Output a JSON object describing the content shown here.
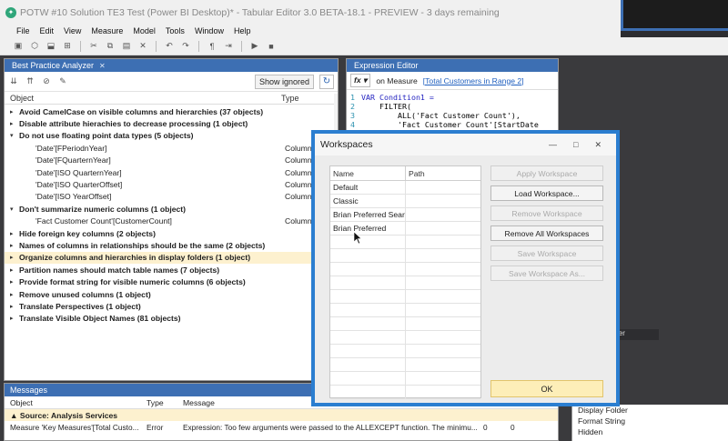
{
  "window": {
    "title": "POTW #10 Solution TE3 Test (Power BI Desktop)* - Tabular Editor 3.0 BETA-18.1 - PREVIEW - 3 days remaining"
  },
  "menu": [
    "File",
    "Edit",
    "View",
    "Measure",
    "Model",
    "Tools",
    "Window",
    "Help"
  ],
  "bpa": {
    "tab_label": "Best Practice Analyzer",
    "show_ignored": "Show ignored",
    "col_object": "Object",
    "col_type": "Type",
    "rows": [
      {
        "kind": "group",
        "text": "Avoid CamelCase on visible columns and hierarchies (37 objects)",
        "type": ""
      },
      {
        "kind": "group",
        "text": "Disable attribute hierachies to decrease processing (1 object)",
        "type": ""
      },
      {
        "kind": "group",
        "text": "Do not use floating point data types (5 objects)",
        "type": ""
      },
      {
        "kind": "child",
        "text": "'Date'[FPeriodnYear]",
        "type": "Column"
      },
      {
        "kind": "child",
        "text": "'Date'[FQuarternYear]",
        "type": "Column"
      },
      {
        "kind": "child",
        "text": "'Date'[ISO QuarternYear]",
        "type": "Column"
      },
      {
        "kind": "child",
        "text": "'Date'[ISO QuarterOffset]",
        "type": "Column"
      },
      {
        "kind": "child",
        "text": "'Date'[ISO YearOffset]",
        "type": "Column"
      },
      {
        "kind": "group",
        "text": "Don't summarize numeric columns (1 object)",
        "type": ""
      },
      {
        "kind": "child",
        "text": "'Fact Customer Count'[CustomerCount]",
        "type": "Column"
      },
      {
        "kind": "group",
        "text": "Hide foreign key columns (2 objects)",
        "type": ""
      },
      {
        "kind": "group",
        "text": "Names of columns in relationships should be the same (2 objects)",
        "type": ""
      },
      {
        "kind": "group",
        "text": "Organize columns and hierarchies in display folders (1 object)",
        "type": ""
      },
      {
        "kind": "group",
        "text": "Partition names should match table names (7 objects)",
        "type": ""
      },
      {
        "kind": "group",
        "text": "Provide format string for visible numeric columns (6 objects)",
        "type": ""
      },
      {
        "kind": "group",
        "text": "Remove unused columns (1 object)",
        "type": ""
      },
      {
        "kind": "group",
        "text": "Translate Perspectives (1 object)",
        "type": ""
      },
      {
        "kind": "group",
        "text": "Translate Visible Object Names (81 objects)",
        "type": ""
      }
    ]
  },
  "expression_editor": {
    "tab_label": "Expression Editor",
    "fx_label": "fx",
    "on_measure_prefix": "on Measure",
    "measure_link": "[Total Customers in Range 2]",
    "code_lines": [
      {
        "num": "1",
        "text": "VAR Condition1 ="
      },
      {
        "num": "2",
        "text": "    FILTER("
      },
      {
        "num": "3",
        "text": "        ALL('Fact Customer Count'),"
      },
      {
        "num": "4",
        "text": "        'Fact Customer Count'[StartDate"
      }
    ]
  },
  "messages": {
    "tab_label": "Messages",
    "col_object": "Object",
    "col_type": "Type",
    "col_message": "Message",
    "group_label": "Source: Analysis Services",
    "row": {
      "object": "Measure 'Key Measures'[Total Custo...",
      "type": "Error",
      "message": "Expression: Too few arguments were passed to the ALLEXCEPT function. The minimu...",
      "line": "0",
      "col": "0"
    }
  },
  "properties": {
    "items": [
      "Display Folder",
      "Format String",
      "Hidden"
    ]
  },
  "right_tab_label": "ler",
  "workspaces_dialog": {
    "title": "Workspaces",
    "col_name": "Name",
    "col_path": "Path",
    "rows": [
      {
        "name": "Default",
        "path": ""
      },
      {
        "name": "Classic",
        "path": ""
      },
      {
        "name": "Brian Preferred Sear...",
        "path": ""
      },
      {
        "name": "Brian  Preferred",
        "path": ""
      }
    ],
    "buttons": [
      {
        "label": "Apply Workspace",
        "enabled": false
      },
      {
        "label": "Load Workspace...",
        "enabled": true
      },
      {
        "label": "Remove Workspace",
        "enabled": false
      },
      {
        "label": "Remove All Workspaces",
        "enabled": true
      },
      {
        "label": "Save Workspace",
        "enabled": false
      },
      {
        "label": "Save Workspace As...",
        "enabled": false
      }
    ],
    "ok_label": "OK"
  }
}
